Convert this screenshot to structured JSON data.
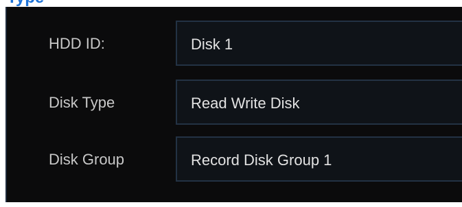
{
  "header": {
    "title": "Type"
  },
  "form": {
    "fields": [
      {
        "label": "HDD ID:",
        "value": "Disk 1"
      },
      {
        "label": "Disk Type",
        "value": "Read Write Disk"
      },
      {
        "label": "Disk Group",
        "value": "Record Disk Group 1"
      }
    ]
  },
  "colors": {
    "accent": "#1e73d8",
    "panel_background": "#0b0b0c",
    "field_background": "#0f1318",
    "field_border": "#233244",
    "label_text": "#c8c8c8",
    "value_text": "#e2e2e2"
  }
}
